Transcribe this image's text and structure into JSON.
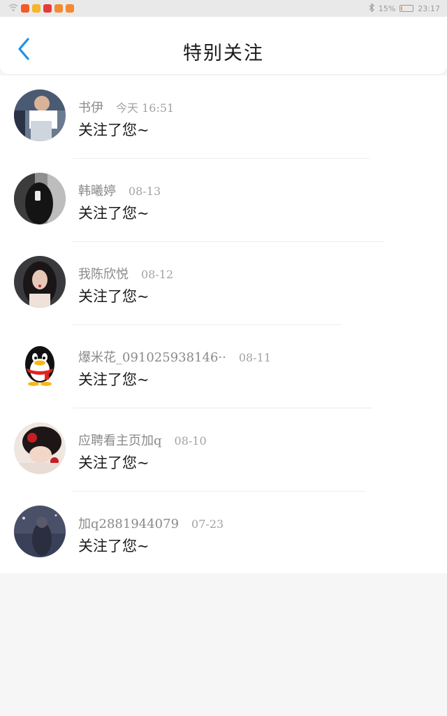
{
  "status_bar": {
    "battery_percent": "15%",
    "battery_level": 0.15,
    "time": "23:17",
    "icons": [
      "wifi-icon",
      "download-icon",
      "shield-icon",
      "video-icon",
      "chat-icon",
      "message-icon",
      "bluetooth-icon",
      "battery-icon"
    ]
  },
  "header": {
    "title": "特别关注",
    "back_icon": "chevron-left-icon",
    "accent_color": "#1e90e6"
  },
  "items": [
    {
      "name": "书伊",
      "time": "今天 16:51",
      "message": "关注了您~"
    },
    {
      "name": "韩曦婷",
      "time": "08-13",
      "message": "关注了您~"
    },
    {
      "name": "我陈欣悦",
      "time": "08-12",
      "message": "关注了您~"
    },
    {
      "name": "爆米花_091025938146··",
      "time": "08-11",
      "message": "关注了您~"
    },
    {
      "name": "应聘看主页加q",
      "time": "08-10",
      "message": "关注了您~"
    },
    {
      "name": "加q2881944079",
      "time": "07-23",
      "message": "关注了您~"
    }
  ]
}
